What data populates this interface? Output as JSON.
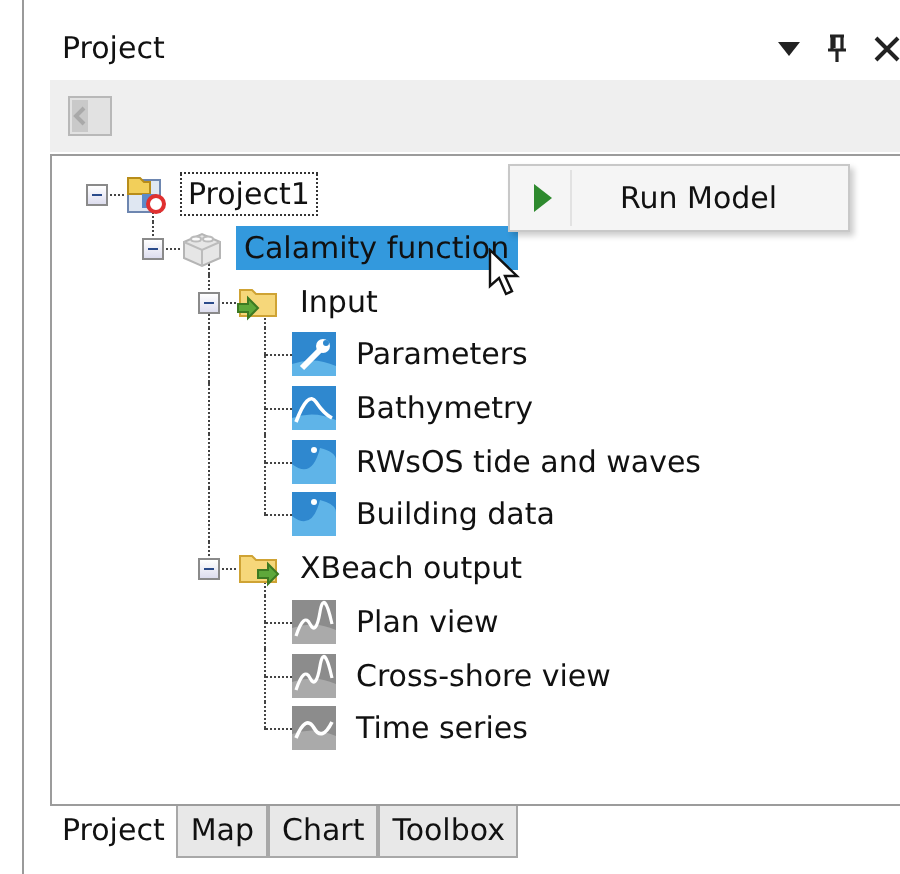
{
  "panel": {
    "title": "Project"
  },
  "tree": [
    {
      "label": "Project1",
      "kind": "project",
      "expanded": true,
      "selected": false,
      "focused": true,
      "children": [
        {
          "label": "Calamity function",
          "kind": "model",
          "expanded": true,
          "selected": true,
          "focused": false,
          "children": [
            {
              "label": "Input",
              "kind": "input-folder",
              "expanded": true,
              "selected": false,
              "focused": false,
              "children": [
                {
                  "label": "Parameters",
                  "kind": "wrench",
                  "selected": false,
                  "focused": false
                },
                {
                  "label": "Bathymetry",
                  "kind": "curve",
                  "selected": false,
                  "focused": false
                },
                {
                  "label": "RWsOS tide and waves",
                  "kind": "wave",
                  "selected": false,
                  "focused": false
                },
                {
                  "label": "Building data",
                  "kind": "wave",
                  "selected": false,
                  "focused": false
                }
              ]
            },
            {
              "label": "XBeach output",
              "kind": "output-folder",
              "expanded": true,
              "selected": false,
              "focused": false,
              "children": [
                {
                  "label": "Plan view",
                  "kind": "chart",
                  "selected": false,
                  "focused": false
                },
                {
                  "label": "Cross-shore view",
                  "kind": "chart",
                  "selected": false,
                  "focused": false
                },
                {
                  "label": "Time series",
                  "kind": "series",
                  "selected": false,
                  "focused": false
                }
              ]
            }
          ]
        }
      ]
    }
  ],
  "context_menu": {
    "items": [
      {
        "label": "Run Model"
      }
    ]
  },
  "tabs": [
    {
      "label": "Project",
      "selected": true
    },
    {
      "label": "Map",
      "selected": false
    },
    {
      "label": "Chart",
      "selected": false
    },
    {
      "label": "Toolbox",
      "selected": false
    }
  ]
}
